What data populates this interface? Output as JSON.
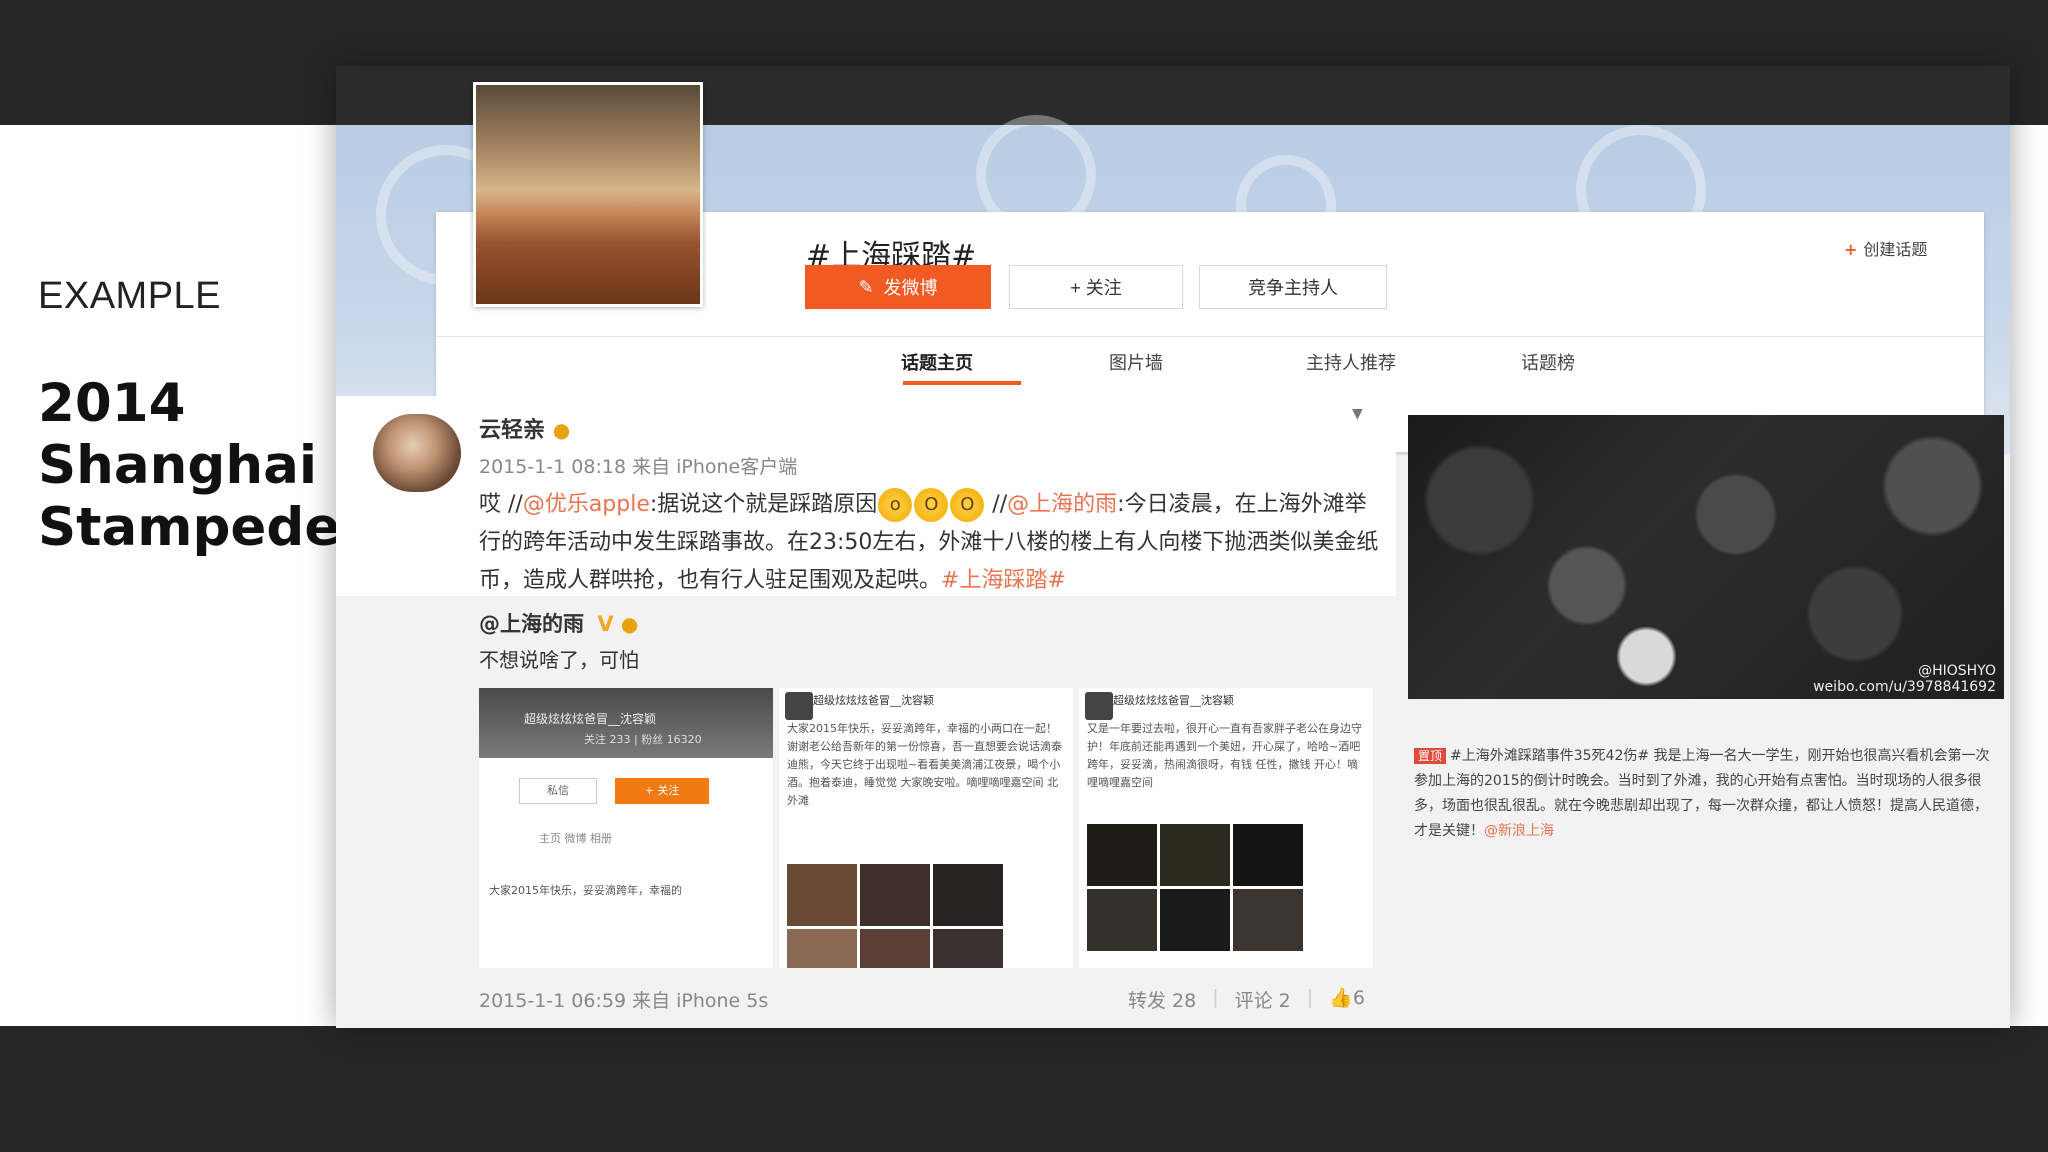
{
  "slide": {
    "label": "EXAMPLE",
    "heading": "2014 Shanghai Stampede"
  },
  "topic": {
    "name": "#上海踩踏#",
    "post_button": "发微博",
    "follow_button": "+ 关注",
    "host_button": "竞争主持人",
    "create_topic": "创建话题",
    "tabs": [
      "话题主页",
      "图片墙",
      "主持人推荐",
      "话题榜"
    ]
  },
  "post": {
    "user": "云轻亲",
    "meta": "2015-1-1 08:18 来自 iPhone客户端",
    "text_prefix": "哎 //",
    "mention1": "@优乐apple",
    "text1": ":据说这个就是踩踏原因",
    "text_sep": " //",
    "mention2": "@上海的雨",
    "text2": ":今日凌晨，在上海外滩举行的跨年活动中发生踩踏事故。在23:50左右，外滩十八楼的楼上有人向楼下抛洒类似美金纸币，造成人群哄抢，也有行人驻足围观及起哄。",
    "hashtag": "#上海踩踏#",
    "repost": {
      "user": "@上海的雨",
      "text": "不想说啥了，可怕",
      "thumb1": {
        "name": "超级炫炫炫爸冒__沈容颖",
        "stats": "关注 233 | 粉丝 16320",
        "btn_msg": "私信",
        "btn_follow": "+ 关注",
        "tabs": "主页   微博   相册",
        "line": "大家2015年快乐，妥妥滴跨年，幸福的"
      },
      "thumb2": {
        "name": "超级炫炫炫爸冒__沈容颖",
        "text": "大家2015年快乐，妥妥滴跨年，幸福的小两口在一起！谢谢老公给吾新年的第一份惊喜，吾一直想要会说话滴泰迪熊，今天它终于出现啦~看看美美滴浦江夜景，喝个小酒。抱着泰迪，睡觉觉 大家晚安啦。嘀哩嘀哩嘉空间 北外滩"
      },
      "thumb3": {
        "name": "超级炫炫炫爸冒__沈容颖",
        "text": "又是一年要过去啦，很开心一直有吾家胖子老公在身边守护！年底前还能再遇到一个美妞，开心屎了，哈哈~酒吧跨年，妥妥滴，热闹滴很呀，有钱 任性，撒钱 开心！嘀哩嘀哩嘉空间"
      }
    },
    "footer_meta": "2015-1-1 06:59 来自 iPhone 5s",
    "reposts": "转发 28",
    "comments": "评论 2",
    "likes": "6"
  },
  "side": {
    "watermark": "@HIOSHYO\nweibo.com/u/3978841692",
    "news_badge": "置顶",
    "news_text": "#上海外滩踩踏事件35死42伤# 我是上海一名大一学生，刚开始也很高兴看机会第一次参加上海的2015的倒计时晚会。当时到了外滩，我的心开始有点害怕。当时现场的人很多很多，场面也很乱很乱。就在今晚悲剧却出现了，每一次群众撞，都让人愤怒！提高人民道德，才是关键！",
    "news_mention": "@新浪上海"
  },
  "colors": {
    "accent": "#f15a22",
    "link": "#eb7350",
    "banner": "#c8d7ea"
  }
}
